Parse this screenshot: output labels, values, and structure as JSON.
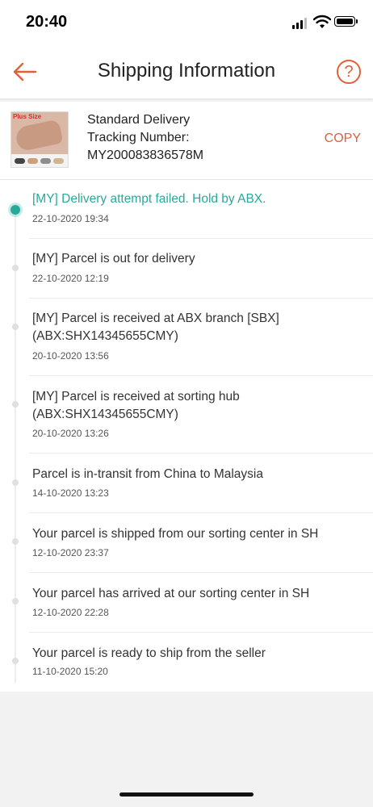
{
  "status_bar": {
    "time": "20:40"
  },
  "header": {
    "title": "Shipping Information",
    "help_label": "?"
  },
  "shipment": {
    "delivery_type": "Standard Delivery",
    "tracking_label": "Tracking Number:",
    "tracking_number": "MY200083836578M",
    "copy_label": "COPY",
    "thumb_text": "Plus Size"
  },
  "events": [
    {
      "title": "[MY] Delivery attempt failed. Hold by ABX.",
      "time": "22-10-2020 19:34",
      "active": true
    },
    {
      "title": "[MY] Parcel is out for delivery",
      "time": "22-10-2020 12:19"
    },
    {
      "title": "[MY] Parcel is received at ABX branch [SBX] (ABX:SHX14345655CMY)",
      "time": "20-10-2020 13:56"
    },
    {
      "title": "[MY] Parcel is received at sorting hub (ABX:SHX14345655CMY)",
      "time": "20-10-2020 13:26"
    },
    {
      "title": "Parcel is in-transit from China to Malaysia",
      "time": "14-10-2020 13:23"
    },
    {
      "title": "Your parcel is shipped from our sorting center in SH",
      "time": "12-10-2020 23:37"
    },
    {
      "title": "Your parcel has arrived at our sorting center in SH",
      "time": "12-10-2020 22:28"
    },
    {
      "title": "Your parcel is ready to ship from the seller",
      "time": "11-10-2020 15:20"
    }
  ],
  "colors": {
    "accent": "#e0603a",
    "active": "#26aa99"
  }
}
